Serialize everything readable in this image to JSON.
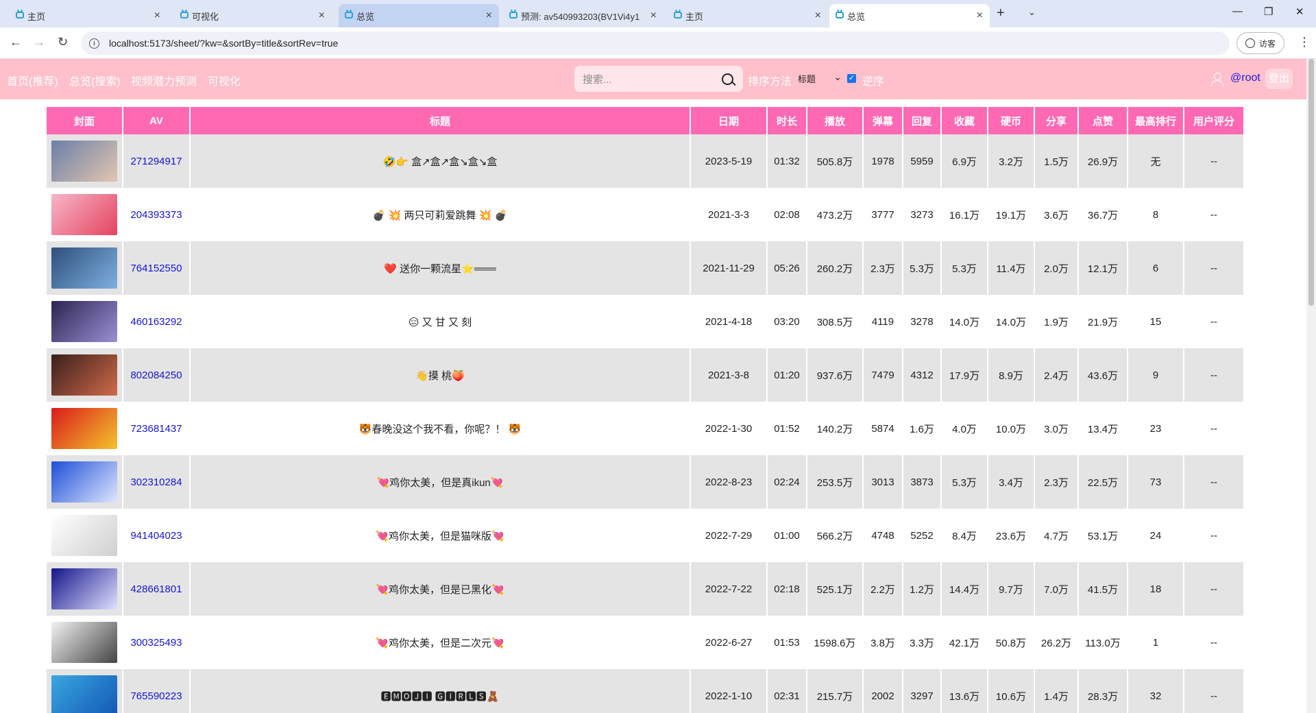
{
  "browser": {
    "tabs": [
      {
        "title": "主页",
        "state": "normal"
      },
      {
        "title": "可视化",
        "state": "normal"
      },
      {
        "title": "总览",
        "state": "selected"
      },
      {
        "title": "预测: av540993203(BV1Vi4y1",
        "state": "normal"
      },
      {
        "title": "主页",
        "state": "normal"
      },
      {
        "title": "总览",
        "state": "active"
      }
    ],
    "url": "localhost:5173/sheet/?kw=&sortBy=title&sortRev=true",
    "profile_label": "访客"
  },
  "header": {
    "nav": [
      "首页(推荐)",
      "总览(搜索)",
      "视频潜力预测",
      "可视化"
    ],
    "search_placeholder": "搜索...",
    "sort_label": "排序方法",
    "sort_value": "标题",
    "reverse_label": "逆序",
    "reverse_checked": true,
    "username": "@root",
    "logout_label": "登出"
  },
  "table": {
    "columns": [
      "封面",
      "AV",
      "标题",
      "日期",
      "时长",
      "播放",
      "弹幕",
      "回复",
      "收藏",
      "硬币",
      "分享",
      "点赞",
      "最高排行",
      "用户评分"
    ],
    "rows": [
      {
        "av": "271294917",
        "title": "🤣👉 盒↗盒↗盒↘盒↘盒",
        "date": "2023-5-19",
        "duration": "01:32",
        "play": "505.8万",
        "danmaku": "1978",
        "reply": "5959",
        "fav": "6.9万",
        "coin": "3.2万",
        "share": "1.5万",
        "like": "26.9万",
        "rank": "无",
        "rating": "--",
        "cover": [
          "#6b7fa8",
          "#e2c6b0"
        ]
      },
      {
        "av": "204393373",
        "title": "💣 💥 两只可莉爱跳舞 💥 💣",
        "date": "2021-3-3",
        "duration": "02:08",
        "play": "473.2万",
        "danmaku": "3777",
        "reply": "3273",
        "fav": "16.1万",
        "coin": "19.1万",
        "share": "3.6万",
        "like": "36.7万",
        "rank": "8",
        "rating": "--",
        "cover": [
          "#f7b6c9",
          "#e4435f"
        ]
      },
      {
        "av": "764152550",
        "title": "❤️ 送你一颗流星⭐═══",
        "date": "2021-11-29",
        "duration": "05:26",
        "play": "260.2万",
        "danmaku": "2.3万",
        "reply": "5.3万",
        "fav": "5.3万",
        "coin": "11.4万",
        "share": "2.0万",
        "like": "12.1万",
        "rank": "6",
        "rating": "--",
        "cover": [
          "#2d4f7c",
          "#7fb0e0"
        ]
      },
      {
        "av": "460163292",
        "title": "😑 又 甘 又 刻",
        "date": "2021-4-18",
        "duration": "03:20",
        "play": "308.5万",
        "danmaku": "4119",
        "reply": "3278",
        "fav": "14.0万",
        "coin": "14.0万",
        "share": "1.9万",
        "like": "21.9万",
        "rank": "15",
        "rating": "--",
        "cover": [
          "#2b2450",
          "#9c8fd6"
        ]
      },
      {
        "av": "802084250",
        "title": "👋摸 桃🍑",
        "date": "2021-3-8",
        "duration": "01:20",
        "play": "937.6万",
        "danmaku": "7479",
        "reply": "4312",
        "fav": "17.9万",
        "coin": "8.9万",
        "share": "2.4万",
        "like": "43.6万",
        "rank": "9",
        "rating": "--",
        "cover": [
          "#3a1f1c",
          "#d06a4a"
        ]
      },
      {
        "av": "723681437",
        "title": "🐯春晚没这个我不看，你呢？！ 🐯",
        "date": "2022-1-30",
        "duration": "01:52",
        "play": "140.2万",
        "danmaku": "5874",
        "reply": "1.6万",
        "fav": "4.0万",
        "coin": "10.0万",
        "share": "3.0万",
        "like": "13.4万",
        "rank": "23",
        "rating": "--",
        "cover": [
          "#d81c1c",
          "#f5c32c"
        ]
      },
      {
        "av": "302310284",
        "title": "💘鸡你太美，但是真ikun💘",
        "date": "2022-8-23",
        "duration": "02:24",
        "play": "253.5万",
        "danmaku": "3013",
        "reply": "3873",
        "fav": "5.3万",
        "coin": "3.4万",
        "share": "2.3万",
        "like": "22.5万",
        "rank": "73",
        "rating": "--",
        "cover": [
          "#1d4fd6",
          "#dfe6ff"
        ]
      },
      {
        "av": "941404023",
        "title": "💘鸡你太美，但是猫咪版💘",
        "date": "2022-7-29",
        "duration": "01:00",
        "play": "566.2万",
        "danmaku": "4748",
        "reply": "5252",
        "fav": "8.4万",
        "coin": "23.6万",
        "share": "4.7万",
        "like": "53.1万",
        "rank": "24",
        "rating": "--",
        "cover": [
          "#ffffff",
          "#cfcfcf"
        ]
      },
      {
        "av": "428661801",
        "title": "💘鸡你太美，但是已黑化💘",
        "date": "2022-7-22",
        "duration": "02:18",
        "play": "525.1万",
        "danmaku": "2.2万",
        "reply": "1.2万",
        "fav": "14.4万",
        "coin": "9.7万",
        "share": "7.0万",
        "like": "41.5万",
        "rank": "18",
        "rating": "--",
        "cover": [
          "#14148a",
          "#e0e0ff"
        ]
      },
      {
        "av": "300325493",
        "title": "💘鸡你太美，但是二次元💘",
        "date": "2022-6-27",
        "duration": "01:53",
        "play": "1598.6万",
        "danmaku": "3.8万",
        "reply": "3.3万",
        "fav": "42.1万",
        "coin": "50.8万",
        "share": "26.2万",
        "like": "113.0万",
        "rank": "1",
        "rating": "--",
        "cover": [
          "#f2f2f2",
          "#444444"
        ]
      },
      {
        "av": "765590223",
        "title": "🅴🅼🅾🅹🅸 🅶🅸🆁🅻🆂🧸",
        "date": "2022-1-10",
        "duration": "02:31",
        "play": "215.7万",
        "danmaku": "2002",
        "reply": "3297",
        "fav": "13.6万",
        "coin": "10.6万",
        "share": "1.4万",
        "like": "28.3万",
        "rank": "32",
        "rating": "--",
        "cover": [
          "#3aa7e0",
          "#1257b5"
        ]
      }
    ]
  }
}
